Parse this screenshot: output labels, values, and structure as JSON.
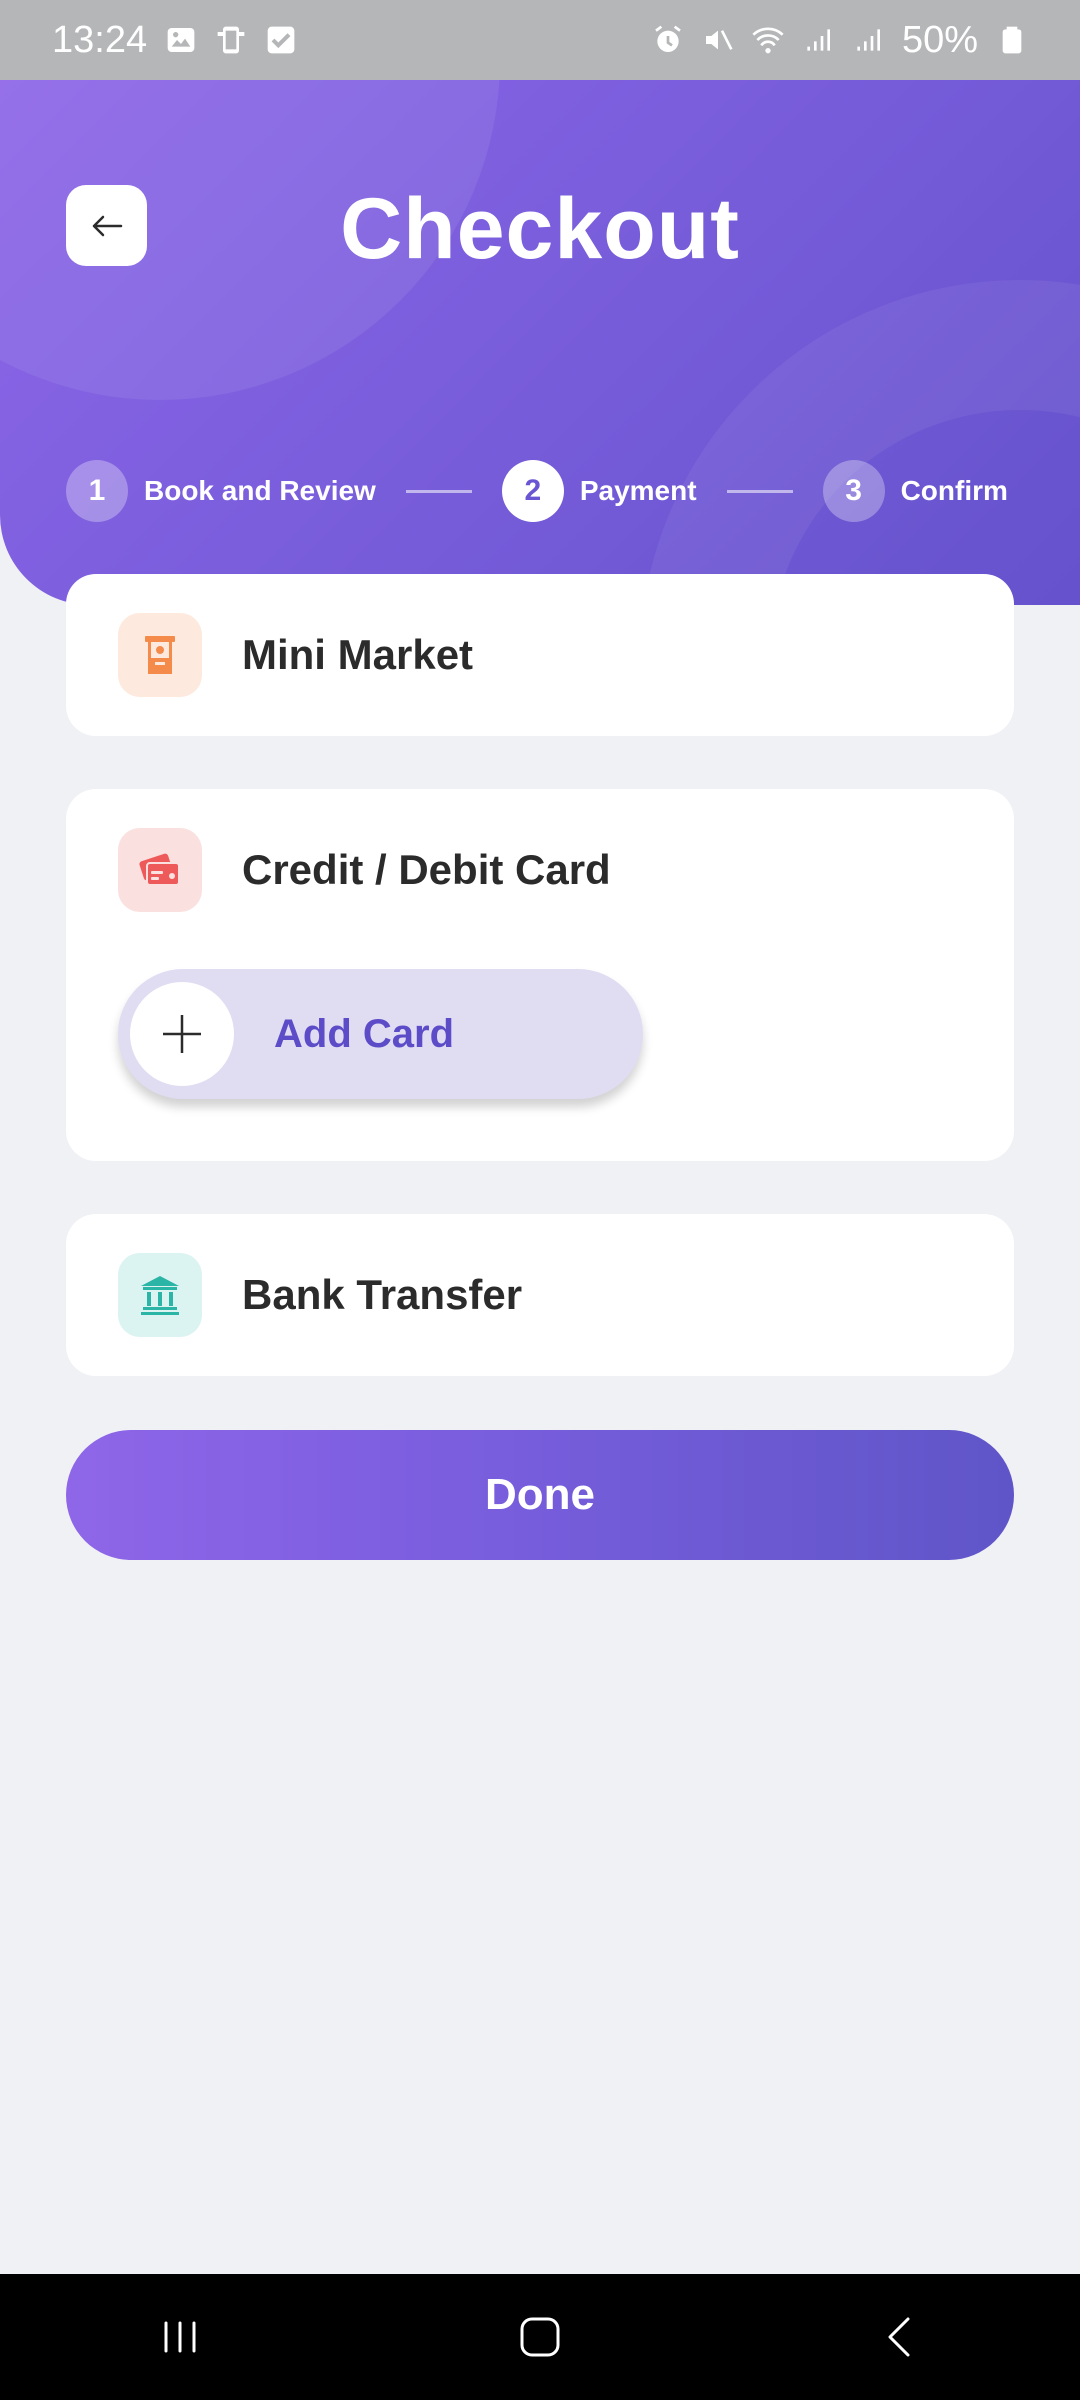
{
  "status_bar": {
    "time": "13:24",
    "battery": "50%",
    "left_icons": [
      "image-icon",
      "device-icon",
      "check-icon"
    ],
    "right_icons": [
      "alarm-icon",
      "mute-icon",
      "wifi-icon",
      "signal-icon",
      "signal-icon-2",
      "battery-icon"
    ]
  },
  "header": {
    "title": "Checkout",
    "back_icon": "arrow-left-icon"
  },
  "stepper": {
    "steps": [
      {
        "number": "1",
        "label": "Book and Review",
        "active": false
      },
      {
        "number": "2",
        "label": "Payment",
        "active": true
      },
      {
        "number": "3",
        "label": "Confirm",
        "active": false
      }
    ]
  },
  "payment_methods": [
    {
      "label": "Mini Market",
      "icon": "store-icon",
      "icon_bg": "#fde9dd",
      "icon_color": "#f48b4a"
    },
    {
      "label": "Credit / Debit Card",
      "icon": "credit-card-icon",
      "icon_bg": "#fbe0e0",
      "icon_color": "#ee5a5a"
    },
    {
      "label": "Bank Transfer",
      "icon": "bank-icon",
      "icon_bg": "#dbf3f1",
      "icon_color": "#2bb5a6"
    }
  ],
  "add_card": {
    "label": "Add Card",
    "icon": "plus-icon"
  },
  "done_button": {
    "label": "Done"
  },
  "colors": {
    "accent": "#6a55d2",
    "background": "#f0f1f5"
  },
  "nav_bar": {
    "icons": [
      "recent-apps-icon",
      "home-icon",
      "back-icon"
    ]
  }
}
